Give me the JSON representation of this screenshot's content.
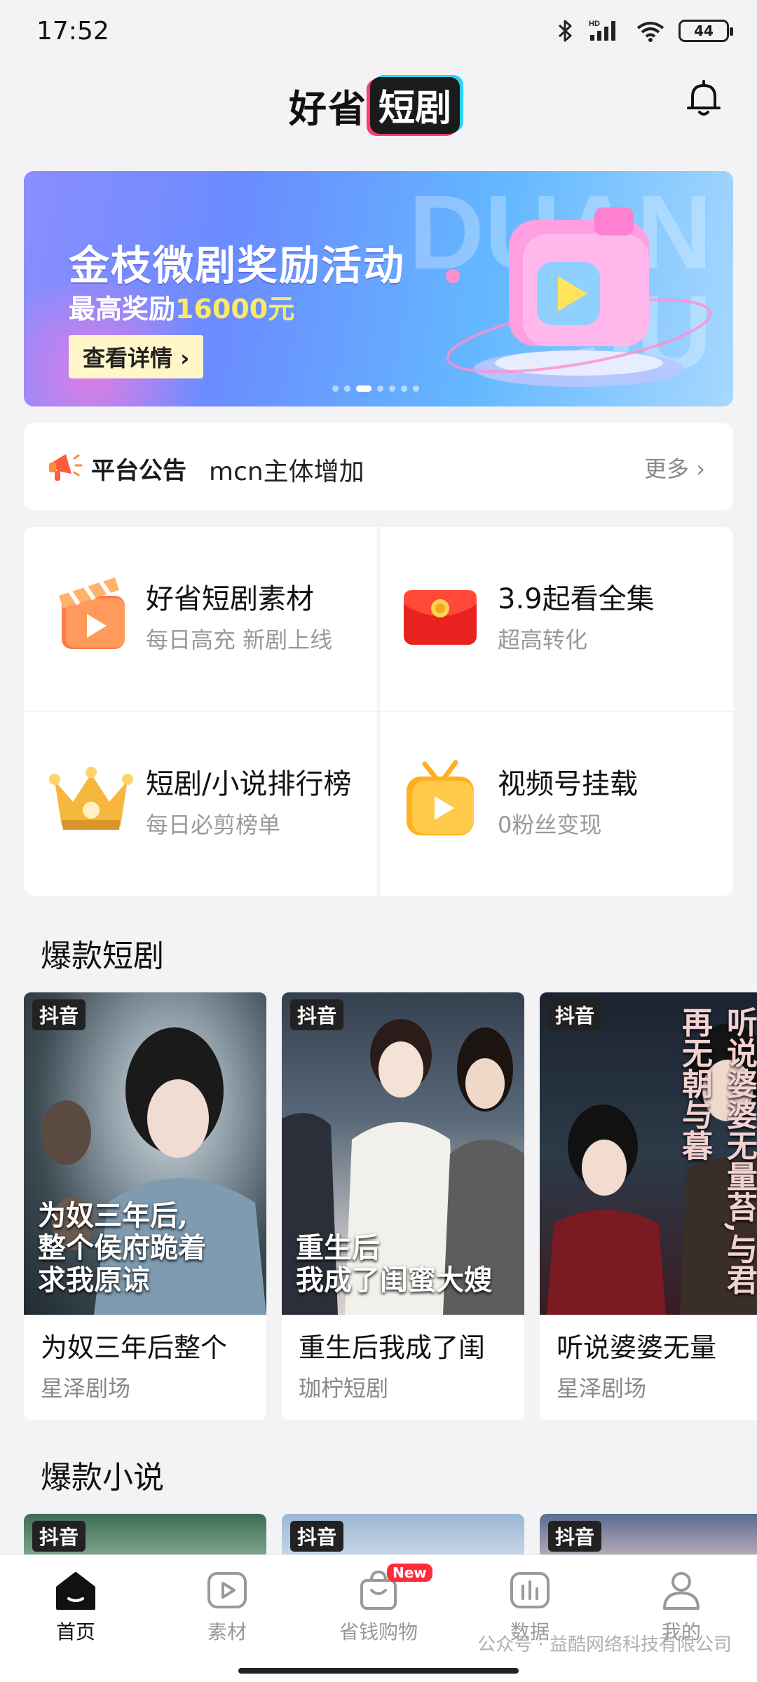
{
  "status_bar": {
    "time": "17:52",
    "network": "HD",
    "battery": "44"
  },
  "header": {
    "logo_part1": "好省",
    "logo_part2": "短剧"
  },
  "banner": {
    "title": "金枝微剧奖励活动",
    "subtitle_prefix": "最高奖励",
    "subtitle_amount": "16000元",
    "button_label": "查看详情 ›",
    "watermark": "DUAN\nJU",
    "page_count": 7,
    "active_page": 3
  },
  "notice": {
    "tag": "平台公告",
    "text": "mcn主体增加",
    "more": "更多 ›"
  },
  "features": [
    {
      "title": "好省短剧素材",
      "subtitle": "每日高充 新剧上线",
      "icon": "clapperboard-icon"
    },
    {
      "title": "3.9起看全集",
      "subtitle": "超高转化",
      "icon": "red-envelope-icon"
    },
    {
      "title": "短剧/小说排行榜",
      "subtitle": "每日必剪榜单",
      "icon": "crown-icon"
    },
    {
      "title": "视频号挂载",
      "subtitle": "0粉丝变现",
      "icon": "tv-icon"
    }
  ],
  "hot_dramas": {
    "title": "爆款短剧",
    "items": [
      {
        "platform": "抖音",
        "title": "为奴三年后整个",
        "studio": "星泽剧场",
        "poster_text": "为奴三年后,\n整个侯府跪着\n求我原谅"
      },
      {
        "platform": "抖音",
        "title": "重生后我成了闺",
        "studio": "珈柠短剧",
        "poster_text": "重生后\n我成了闺蜜大嫂"
      },
      {
        "platform": "抖音",
        "title": "听说婆婆无量",
        "studio": "星泽剧场",
        "poster_text": "听说婆婆无量苔,与君再无朝与暮"
      }
    ]
  },
  "hot_novels": {
    "title": "爆款小说",
    "items": [
      {
        "platform": "抖音"
      },
      {
        "platform": "抖音"
      },
      {
        "platform": "抖音"
      }
    ]
  },
  "bottom_nav": {
    "items": [
      {
        "label": "首页",
        "icon": "home-icon",
        "active": true
      },
      {
        "label": "素材",
        "icon": "play-square-icon",
        "active": false
      },
      {
        "label": "省钱购物",
        "icon": "shopping-bag-icon",
        "active": false,
        "badge": "New"
      },
      {
        "label": "数据",
        "icon": "bar-chart-icon",
        "active": false
      },
      {
        "label": "我的",
        "icon": "user-icon",
        "active": false
      }
    ]
  },
  "watermark": "公众号 · 益酷网络科技有限公司",
  "colors": {
    "accent": "#ff2b3b",
    "highlight": "#ffe866",
    "dark": "#1b1b1b"
  }
}
